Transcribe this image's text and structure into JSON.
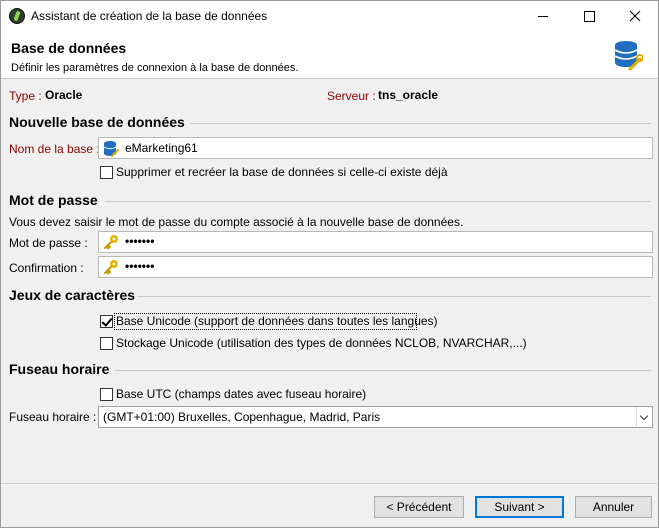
{
  "window": {
    "title": "Assistant de création de la base de données"
  },
  "header": {
    "title": "Base de données",
    "subtitle": "Définir les paramètres de connexion à la base de données."
  },
  "info": {
    "type_label": "Type :",
    "type_value": "Oracle",
    "server_label": "Serveur :",
    "server_value": "tns_oracle"
  },
  "new_db": {
    "section_title": "Nouvelle base de données",
    "name_label": "Nom de la base :",
    "name_value": "eMarketing61",
    "recreate_label": "Supprimer et recréer la base de données si celle-ci existe déjà",
    "recreate_checked": false
  },
  "password": {
    "section_title": "Mot de passe",
    "instruction": "Vous devez saisir le mot de passe du compte associé à la nouvelle base de données.",
    "password_label": "Mot de passe :",
    "password_value": "•••••••",
    "confirm_label": "Confirmation :",
    "confirm_value": "•••••••"
  },
  "charsets": {
    "section_title": "Jeux de caractères",
    "unicode_label": "Base Unicode (support de données dans toutes les langues)",
    "unicode_checked": true,
    "storage_label": "Stockage Unicode (utilisation des types de données NCLOB, NVARCHAR,...)",
    "storage_checked": false
  },
  "timezone": {
    "section_title": "Fuseau horaire",
    "utc_label": "Base UTC (champs dates avec fuseau horaire)",
    "utc_checked": false,
    "tz_label": "Fuseau horaire :",
    "tz_selected": "(GMT+01:00) Bruxelles, Copenhague, Madrid, Paris"
  },
  "footer": {
    "prev_label": "< Précédent",
    "next_label": "Suivant >",
    "cancel_label": "Annuler"
  },
  "colors": {
    "label_red": "#8b0000",
    "default_button_border": "#0078d7",
    "dialog_bg": "#f0f0f0"
  },
  "icons": {
    "app": "app-logo-icon",
    "database": "database-wrench-icon",
    "db_field": "database-icon",
    "key": "key-icon"
  }
}
